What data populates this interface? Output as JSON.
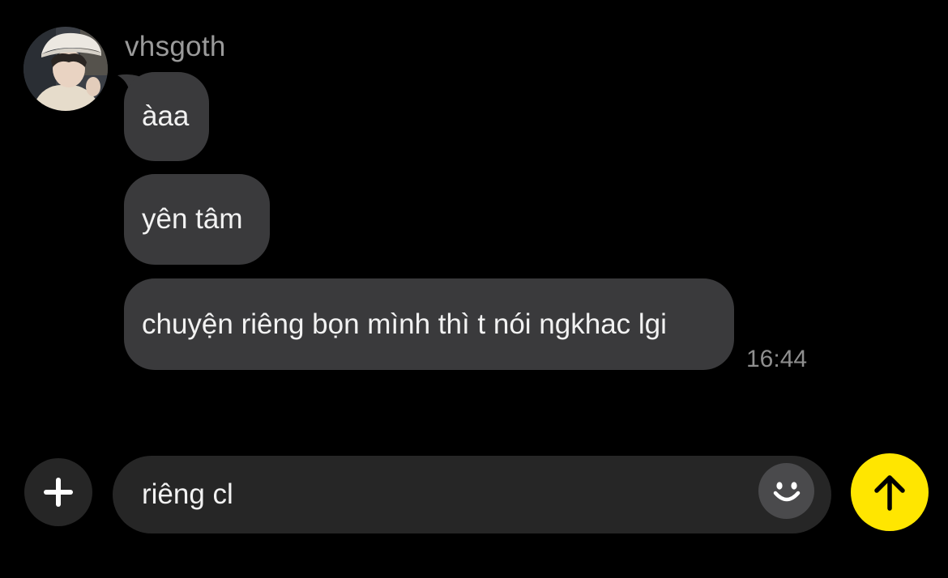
{
  "conversation": {
    "sender_name": "vhsgoth",
    "messages": [
      {
        "text": "àaa"
      },
      {
        "text": "yên tâm"
      },
      {
        "text": "chuyện riêng bọn mình thì t nói ngkhac lgi"
      }
    ],
    "last_timestamp": "16:44"
  },
  "composer": {
    "input_value": "riêng cl"
  },
  "icons": {
    "plus": "plus-icon",
    "emoji": "smiley-face-icon",
    "send": "arrow-up-icon"
  },
  "colors": {
    "background": "#000000",
    "bubble": "#3a3a3c",
    "input": "#262626",
    "send_accent": "#ffe600"
  }
}
